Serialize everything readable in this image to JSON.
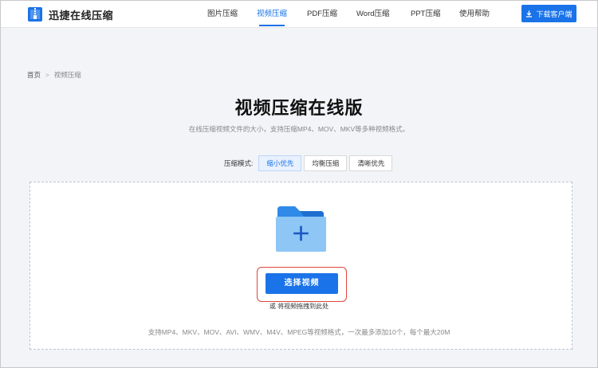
{
  "header": {
    "logo_text": "迅捷在线压缩",
    "nav": [
      {
        "label": "图片压缩",
        "active": false
      },
      {
        "label": "视频压缩",
        "active": true
      },
      {
        "label": "PDF压缩",
        "active": false
      },
      {
        "label": "Word压缩",
        "active": false
      },
      {
        "label": "PPT压缩",
        "active": false
      },
      {
        "label": "使用帮助",
        "active": false
      }
    ],
    "download_label": "下载客户端"
  },
  "breadcrumb": {
    "home": "首页",
    "separator": ">",
    "current": "视频压缩"
  },
  "main": {
    "title": "视频压缩在线版",
    "subtitle": "在线压缩视频文件的大小，支持压缩MP4、MOV、MKV等多种视频格式。"
  },
  "mode": {
    "label": "压缩模式:",
    "options": [
      {
        "label": "缩小优先",
        "active": true
      },
      {
        "label": "均衡压缩",
        "active": false
      },
      {
        "label": "清晰优先",
        "active": false
      }
    ]
  },
  "upload": {
    "select_label": "选择视频",
    "drag_hint": "或 将视频拖拽到此处",
    "support_text": "支持MP4、MKV、MOV、AVI、WMV、M4V、MPEG等视频格式，一次最多添加10个，每个最大20M"
  },
  "colors": {
    "accent": "#1a73e8",
    "highlight_outline": "#e0463c",
    "folder_back": "#2f8ae8",
    "folder_front": "#8ec6f5"
  },
  "icons": {
    "logo": "zip-file-icon",
    "download": "download-icon",
    "folder": "folder-add-icon"
  }
}
